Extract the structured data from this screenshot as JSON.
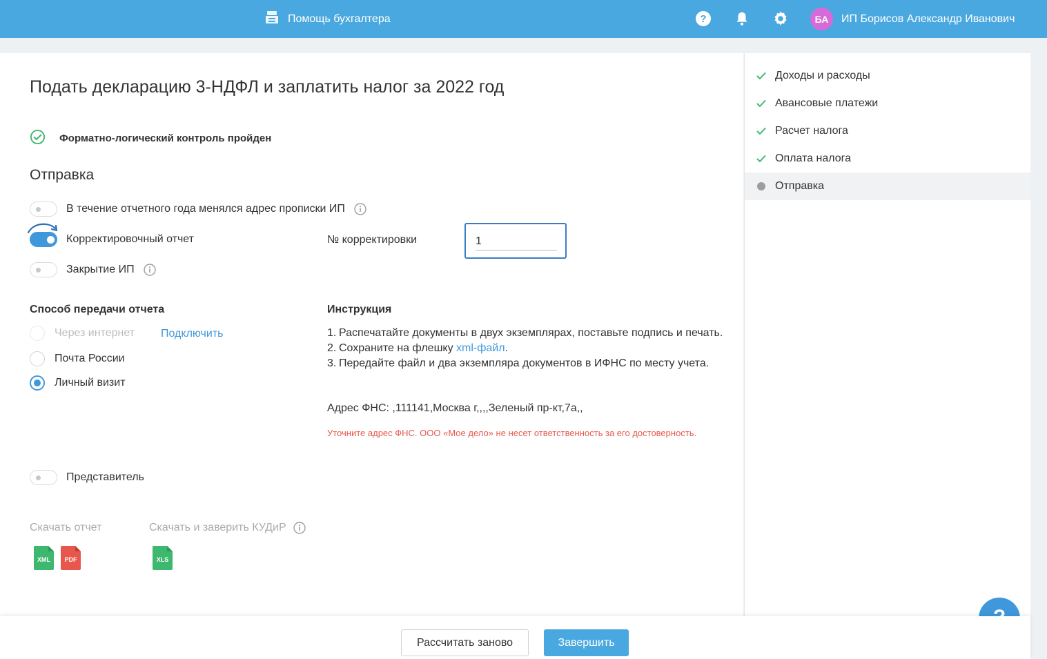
{
  "header": {
    "helper_label": "Помощь бухгалтера",
    "user_initials": "БА",
    "user_name": "ИП Борисов Александр Иванович"
  },
  "page": {
    "title": "Подать декларацию 3-НДФЛ и заплатить налог за 2022 год",
    "flk_status": "Форматно-логический контроль пройден",
    "section_title": "Отправка"
  },
  "toggles": {
    "address_changed": {
      "label": "В течение отчетного года менялся адрес прописки ИП",
      "on": false
    },
    "correction_report": {
      "label": "Корректировочный отчет",
      "on": true
    },
    "closing": {
      "label": "Закрытие ИП",
      "on": false
    },
    "representative": {
      "label": "Представитель",
      "on": false
    }
  },
  "correction": {
    "label": "№ корректировки",
    "value": "1"
  },
  "delivery": {
    "heading": "Способ передачи отчета",
    "options": [
      {
        "label": "Через интернет",
        "selected": false,
        "disabled": true
      },
      {
        "label": "Почта России",
        "selected": false,
        "disabled": false
      },
      {
        "label": "Личный визит",
        "selected": true,
        "disabled": false
      }
    ],
    "connect_link": "Подключить"
  },
  "instruction": {
    "heading": "Инструкция",
    "items": [
      {
        "num": "1.",
        "text": "Распечатайте документы в двух экземплярах, поставьте подпись и печать."
      },
      {
        "num": "2.",
        "text_before": "Сохраните на флешку ",
        "link": "xml-файл",
        "text_after": "."
      },
      {
        "num": "3.",
        "text": "Передайте файл и два экземпляра документов в ИФНС по месту учета."
      }
    ],
    "fns_address": "Адрес ФНС: ,111141,Москва г,,,,Зеленый пр-кт,7а,,",
    "warning": "Уточните адрес ФНС. ООО «Мое дело» не несет ответственность за его достоверность."
  },
  "downloads": {
    "report_label": "Скачать отчет",
    "kudir_label": "Скачать и заверить КУДиР",
    "files": [
      {
        "label": "XML",
        "color": "#3fb86f"
      },
      {
        "label": "PDF",
        "color": "#e8574d"
      },
      {
        "label": "XLS",
        "color": "#3fb86f"
      }
    ]
  },
  "footer": {
    "recalc_label": "Рассчитать заново",
    "finish_label": "Завершить"
  },
  "steps": [
    {
      "label": "Доходы и расходы",
      "status": "done"
    },
    {
      "label": "Авансовые платежи",
      "status": "done"
    },
    {
      "label": "Расчет налога",
      "status": "done"
    },
    {
      "label": "Оплата налога",
      "status": "done"
    },
    {
      "label": "Отправка",
      "status": "current"
    }
  ],
  "colors": {
    "header": "#4aa8e0",
    "accent": "#3f98dc",
    "success": "#3fb86f",
    "warning": "#e8574d"
  }
}
